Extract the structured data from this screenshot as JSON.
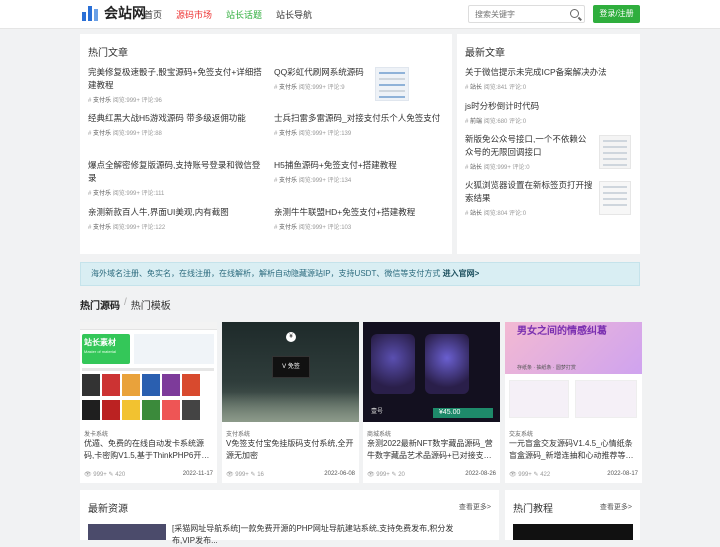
{
  "header": {
    "logo_text": "会站网",
    "nav": [
      "首页",
      "源码市场",
      "站长话题",
      "站长导航"
    ],
    "search_placeholder": "搜索关键字",
    "login_label": "登录/注册",
    "colors": {
      "brand": "#2a6fd6",
      "accent_red": "#e33333",
      "accent_green": "#2fae3d"
    }
  },
  "hot_articles": {
    "title": "热门文章",
    "items": [
      {
        "title": "完美修复极速骰子,骰宝源码+免签支付+详细搭建教程",
        "author": "支付乐",
        "meta": "阅览:999+ 评论:96"
      },
      {
        "title": "QQ彩虹代刷网系统源码",
        "author": "支付乐",
        "meta": "阅览:999+ 评论:9"
      },
      {
        "title": "经典红黑大战H5游戏源码 带多级返佣功能",
        "author": "支付乐",
        "meta": "阅览:999+ 评论:88"
      },
      {
        "title": "士兵扫雷多雷源码_对接支付乐个人免签支付",
        "author": "支付乐",
        "meta": "阅览:999+ 评论:139"
      },
      {
        "title": "爆点全解密修复版源码,支持账号登录和微信登录",
        "author": "支付乐",
        "meta": "阅览:999+ 评论:111"
      },
      {
        "title": "H5捕鱼源码+免签支付+搭建教程",
        "author": "支付乐",
        "meta": "阅览:999+ 评论:134"
      },
      {
        "title": "亲测新款百人牛,界面UI美观,内有截图",
        "author": "支付乐",
        "meta": "阅览:999+ 评论:122"
      },
      {
        "title": "亲测牛牛联盟HD+免签支付+搭建教程",
        "author": "支付乐",
        "meta": "阅览:999+ 评论:103"
      }
    ]
  },
  "latest_articles": {
    "title": "最新文章",
    "items": [
      {
        "title": "关于微信提示未完成ICP备案解决办法",
        "author": "站长",
        "meta": "阅览:841 评论:0"
      },
      {
        "title": "js时分秒倒计时代码",
        "author": "前端",
        "meta": "阅览:680 评论:0"
      },
      {
        "title": "新版免公众号接口,一个不依赖公众号的无限回调接口",
        "author": "站长",
        "meta": "阅览:999+ 评论:0"
      },
      {
        "title": "火狐浏览器设置在新标签页打开搜索结果",
        "author": "站长",
        "meta": "阅览:804 评论:0"
      }
    ]
  },
  "banner": {
    "text": "海外域名注册、免实名，在线注册，在线解析，解析自动隐藏源站IP，支持USDT、微信等支付方式",
    "link": "进入官网>"
  },
  "tabs": {
    "active": "热门源码",
    "separator": "/",
    "other": "热门模板"
  },
  "cards": [
    {
      "category": "发卡系统",
      "title": "优遁、免费的在线自动发卡系统源码,卡密购V1.5,基于ThinkPHP6开…",
      "views": "999+",
      "comments": "420",
      "date": "2022-11-17",
      "img_label": "站长素材",
      "img_sub": "Master of material"
    },
    {
      "category": "支付系统",
      "title": "V免签支付宝免挂版码支付系统,全开源无加密",
      "views": "999+",
      "comments": "16",
      "date": "2022-06-08",
      "img_label": "V 免签"
    },
    {
      "category": "商城系统",
      "title": "亲测2022最新NFT数字藏品源码_营牛数字藏品艺术品源码+已对接支…",
      "views": "999+",
      "comments": "20",
      "date": "2022-08-26",
      "img_label": "壹号",
      "img_price": "¥45.00"
    },
    {
      "category": "交友系统",
      "title": "一元盲盒交友源码V1.4.5_心情纸条盲盒源码_新增连抽和心动推荐等…",
      "views": "999+",
      "comments": "422",
      "date": "2022-08-17",
      "img_label": "男女之间的情感纠葛",
      "img_sub": "存纸条 · 抽纸条 · 圆梦打赏"
    }
  ],
  "bottom": {
    "latest_title": "最新资源",
    "latest_more": "查看更多>",
    "latest_first": "[采猫网址导航系统]一款免费开源的PHP网址导航建站系统,支持免费发布,积分发布,VIP发布...",
    "tutorial_title": "热门教程",
    "tutorial_more": "查看更多>"
  }
}
